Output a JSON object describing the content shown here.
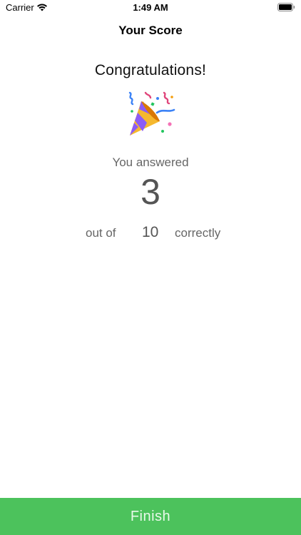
{
  "status_bar": {
    "carrier": "Carrier",
    "time": "1:49 AM",
    "wifi_icon": "wifi-icon",
    "battery_icon": "battery-icon"
  },
  "nav": {
    "title": "Your Score"
  },
  "result": {
    "headline": "Congratulations!",
    "celebration_icon": "party-popper-icon",
    "answered_label": "You answered",
    "score": "3",
    "out_of_label": "out of",
    "total": "10",
    "correctly_label": "correctly"
  },
  "actions": {
    "finish_label": "Finish"
  },
  "colors": {
    "finish_button": "#4cc25c",
    "muted_text": "#666666"
  }
}
